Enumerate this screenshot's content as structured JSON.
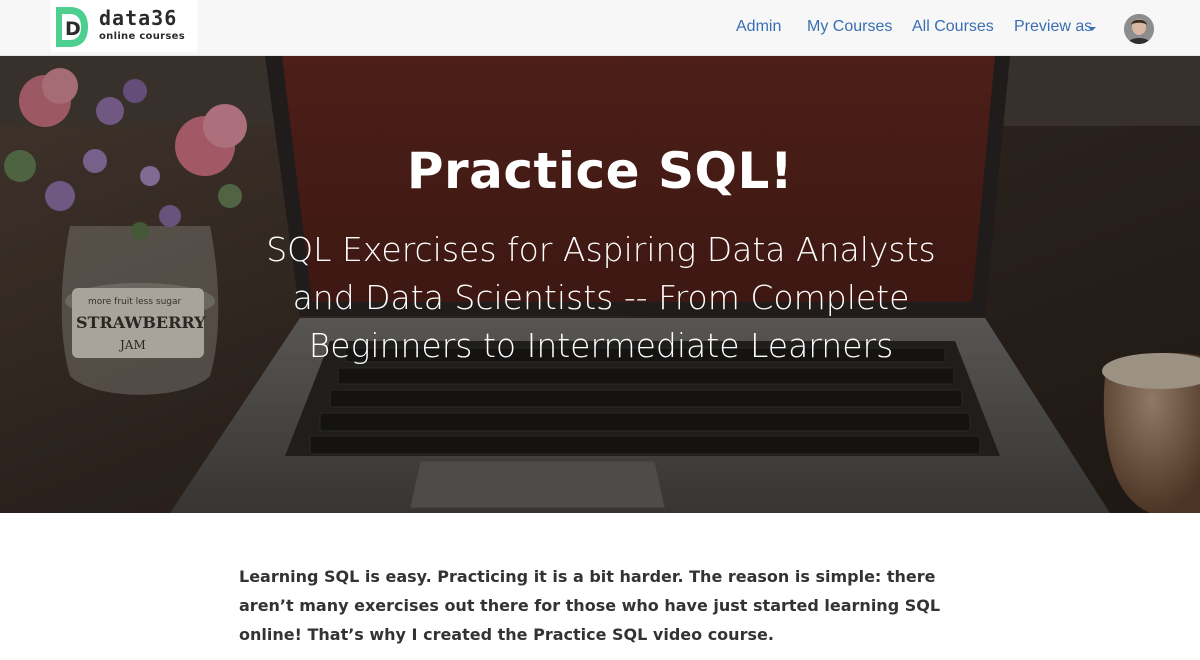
{
  "brand": {
    "logo_letter": "D",
    "name": "data36",
    "tagline": "online courses",
    "accent_color": "#4ccf8f"
  },
  "nav": {
    "items": [
      {
        "label": "Admin"
      },
      {
        "label": "My Courses"
      },
      {
        "label": "All Courses"
      },
      {
        "label": "Preview as"
      }
    ],
    "link_color": "#3a6eb3",
    "dropdown_icon": "caret-down-icon",
    "avatar_icon": "user-avatar"
  },
  "hero": {
    "title": "Practice SQL!",
    "subtitle": "SQL Exercises for Aspiring Data Analysts and Data Scientists -- From Complete Beginners to Intermediate Learners",
    "jar_label": {
      "top": "more fruit less sugar",
      "main": "STRAWBERRY",
      "bottom": "JAM"
    }
  },
  "content": {
    "intro": "Learning SQL is easy. Practicing it is a bit harder. The reason is simple: there aren’t many exercises out there for those who have just started learning SQL online! That’s why I created the Practice SQL video course."
  }
}
